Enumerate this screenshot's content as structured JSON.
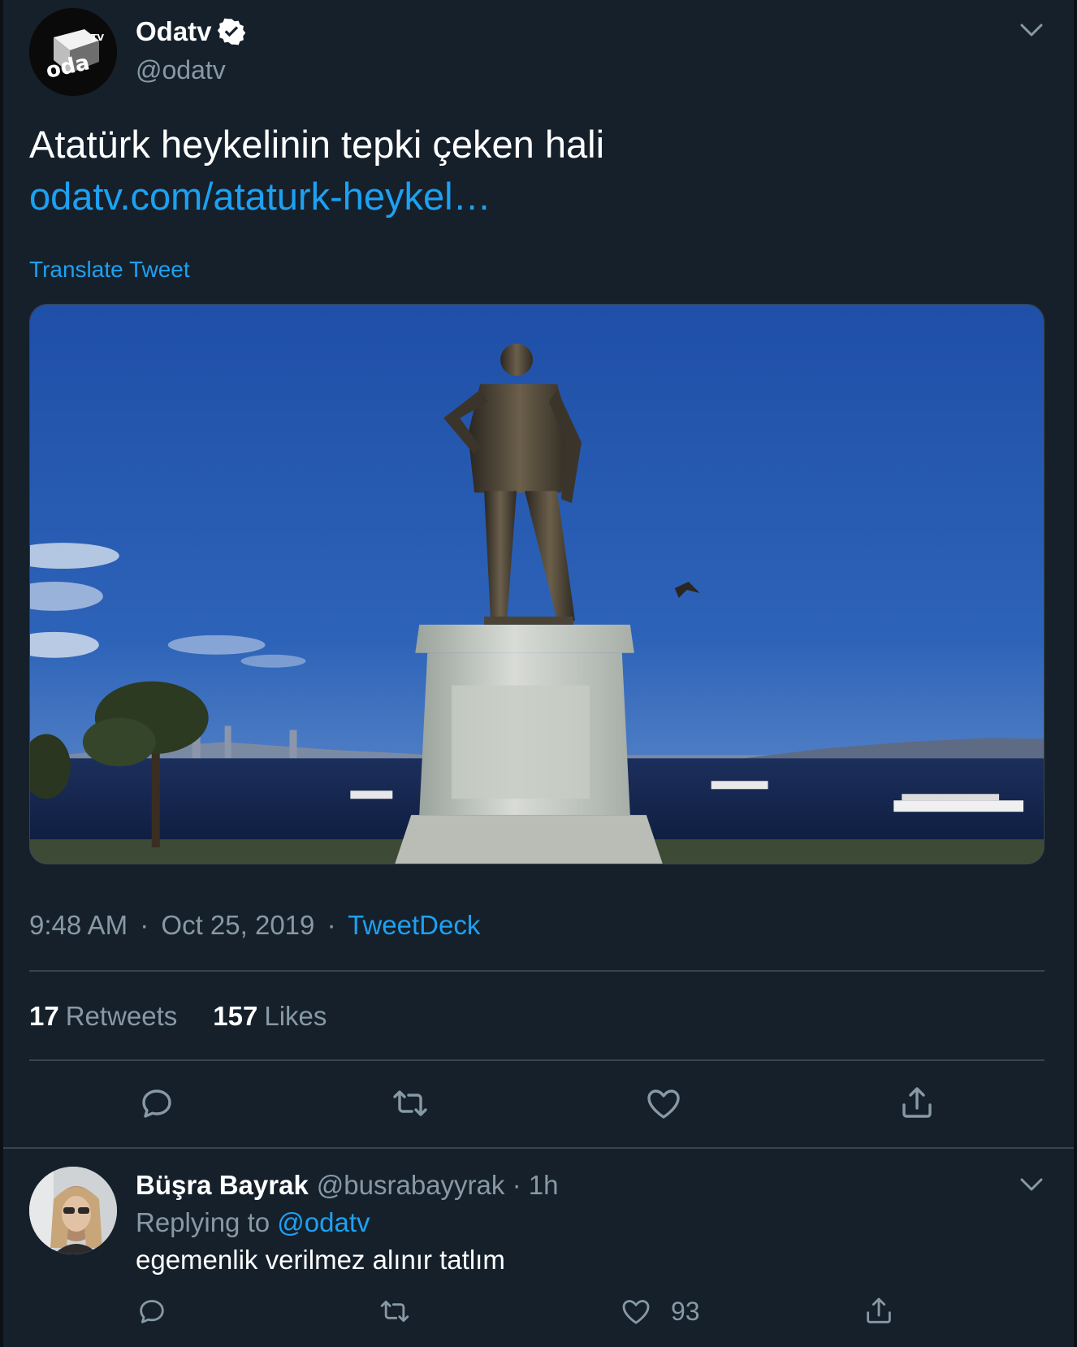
{
  "tweet": {
    "author_name": "Odatv",
    "author_handle": "@odatv",
    "avatar_logo_text": "odaTV",
    "text": "Atatürk heykelinin tepki çeken hali",
    "link": "odatv.com/ataturk-heykel…",
    "translate_label": "Translate Tweet",
    "time": "9:48 AM",
    "date": "Oct 25, 2019",
    "separator": "·",
    "source": "TweetDeck",
    "retweets_count": "17",
    "retweets_label": "Retweets",
    "likes_count": "157",
    "likes_label": "Likes"
  },
  "reply": {
    "author_name": "Büşra Bayrak",
    "author_handle": "@busrabayyrak",
    "separator": "·",
    "age": "1h",
    "replying_label": "Replying to",
    "replying_to": "@odatv",
    "text": "egemenlik verilmez alınır tatlım",
    "like_count": "93"
  },
  "icons": {
    "reply": "reply-icon",
    "retweet": "retweet-icon",
    "like": "heart-icon",
    "share": "share-icon",
    "verified": "verified-badge-icon",
    "caret": "chevron-down-icon"
  },
  "colors": {
    "background": "#15202b",
    "accent": "#1da1f2",
    "secondary_text": "#8899a6",
    "divider": "#38444d"
  }
}
